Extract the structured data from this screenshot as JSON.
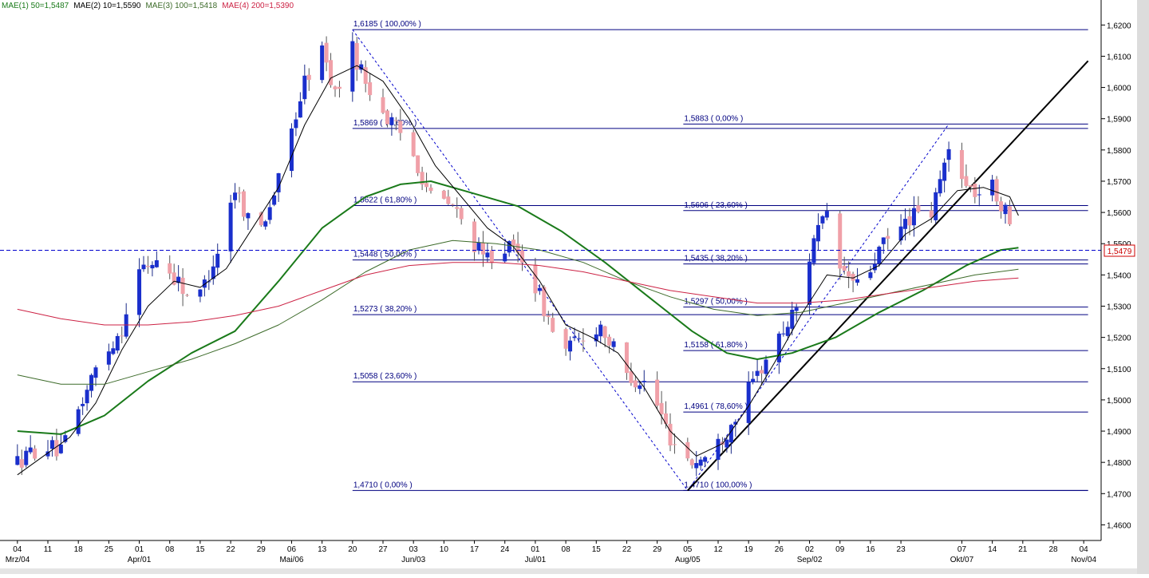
{
  "legend": [
    {
      "label": "MAE(1) 50=1,5487",
      "color": "#1a7a1a"
    },
    {
      "label": "MAE(2) 10=1,5590",
      "color": "#000000"
    },
    {
      "label": "MAE(3) 100=1,5418",
      "color": "#3d6b2a"
    },
    {
      "label": "MAE(4) 200=1,5390",
      "color": "#cc2244"
    }
  ],
  "current_price": "1,5479",
  "colors": {
    "bull": "#1a2fcc",
    "bear": "#f0a0a8",
    "fib": "#000080",
    "price_line": "#0000cc",
    "trend": "#000000"
  },
  "chart_data": {
    "type": "candlestick",
    "ylim": [
      1.455,
      1.628
    ],
    "yticks": [
      {
        "v": 1.46,
        "label": "1,4600"
      },
      {
        "v": 1.47,
        "label": "1,4700"
      },
      {
        "v": 1.48,
        "label": "1,4800"
      },
      {
        "v": 1.49,
        "label": "1,4900"
      },
      {
        "v": 1.5,
        "label": "1,5000"
      },
      {
        "v": 1.51,
        "label": "1,5100"
      },
      {
        "v": 1.52,
        "label": "1,5200"
      },
      {
        "v": 1.53,
        "label": "1,5300"
      },
      {
        "v": 1.54,
        "label": "1,5400"
      },
      {
        "v": 1.55,
        "label": "1,5500"
      },
      {
        "v": 1.56,
        "label": "1,5600"
      },
      {
        "v": 1.57,
        "label": "1,5700"
      },
      {
        "v": 1.58,
        "label": "1,5800"
      },
      {
        "v": 1.59,
        "label": "1,5900"
      },
      {
        "v": 1.6,
        "label": "1,6000"
      },
      {
        "v": 1.61,
        "label": "1,6100"
      },
      {
        "v": 1.62,
        "label": "1,6200"
      }
    ],
    "xticks": [
      {
        "d": 0,
        "label": "04"
      },
      {
        "d": 7,
        "label": "11"
      },
      {
        "d": 14,
        "label": "18"
      },
      {
        "d": 21,
        "label": "25"
      },
      {
        "d": 28,
        "label": "01"
      },
      {
        "d": 35,
        "label": "08"
      },
      {
        "d": 42,
        "label": "15"
      },
      {
        "d": 49,
        "label": "22"
      },
      {
        "d": 56,
        "label": "29"
      },
      {
        "d": 63,
        "label": "06"
      },
      {
        "d": 70,
        "label": "13"
      },
      {
        "d": 77,
        "label": "20"
      },
      {
        "d": 84,
        "label": "27"
      },
      {
        "d": 91,
        "label": "03"
      },
      {
        "d": 98,
        "label": "10"
      },
      {
        "d": 105,
        "label": "17"
      },
      {
        "d": 112,
        "label": "24"
      },
      {
        "d": 119,
        "label": "01"
      },
      {
        "d": 126,
        "label": "08"
      },
      {
        "d": 133,
        "label": "15"
      },
      {
        "d": 140,
        "label": "22"
      },
      {
        "d": 147,
        "label": "29"
      },
      {
        "d": 154,
        "label": "05"
      },
      {
        "d": 161,
        "label": "12"
      },
      {
        "d": 168,
        "label": "19"
      },
      {
        "d": 175,
        "label": "26"
      },
      {
        "d": 182,
        "label": "02"
      },
      {
        "d": 189,
        "label": "09"
      },
      {
        "d": 196,
        "label": "16"
      },
      {
        "d": 203,
        "label": "23"
      },
      {
        "d": 217,
        "label": "07"
      },
      {
        "d": 224,
        "label": "14"
      },
      {
        "d": 231,
        "label": "21"
      },
      {
        "d": 238,
        "label": "28"
      },
      {
        "d": 245,
        "label": "04"
      }
    ],
    "month_labels": [
      {
        "d": 0,
        "label": "Mrz/04"
      },
      {
        "d": 28,
        "label": "Apr/01"
      },
      {
        "d": 63,
        "label": "Mai/06"
      },
      {
        "d": 91,
        "label": "Jun/03"
      },
      {
        "d": 119,
        "label": "Jul/01"
      },
      {
        "d": 154,
        "label": "Aug/05"
      },
      {
        "d": 182,
        "label": "Sep/02"
      },
      {
        "d": 217,
        "label": "Okt/07"
      },
      {
        "d": 245,
        "label": "Nov/04"
      }
    ],
    "fib_sets": [
      {
        "d_start": 77,
        "d_end": 246,
        "levels": [
          {
            "v": 1.6185,
            "label": "1,6185 ( 100,00% )"
          },
          {
            "v": 1.5869,
            "label": "1,5869 ( 78,60% )"
          },
          {
            "v": 1.5622,
            "label": "1,5622 ( 61,80% )"
          },
          {
            "v": 1.5448,
            "label": "1,5448 ( 50,00% )"
          },
          {
            "v": 1.5273,
            "label": "1,5273 ( 38,20% )"
          },
          {
            "v": 1.5058,
            "label": "1,5058 ( 23,60% )"
          },
          {
            "v": 1.471,
            "label": "1,4710 ( 0,00% )"
          }
        ]
      },
      {
        "d_start": 153,
        "d_end": 246,
        "levels": [
          {
            "v": 1.5883,
            "label": "1,5883 ( 0,00% )"
          },
          {
            "v": 1.5606,
            "label": "1,5606 ( 23,60% )"
          },
          {
            "v": 1.5435,
            "label": "1,5435 ( 38,20% )"
          },
          {
            "v": 1.5297,
            "label": "1,5297 ( 50,00% )"
          },
          {
            "v": 1.5158,
            "label": "1,5158 ( 61,80% )"
          },
          {
            "v": 1.4961,
            "label": "1,4961 ( 78,60% )"
          },
          {
            "v": 1.471,
            "label": "1,4710 ( 100,00% )"
          }
        ]
      }
    ],
    "swing_lines": [
      {
        "d1": 77,
        "v1": 1.6185,
        "d2": 154,
        "v2": 1.471
      },
      {
        "d1": 154,
        "v1": 1.471,
        "d2": 214,
        "v2": 1.5883
      }
    ],
    "trend_line": {
      "d1": 154,
      "v1": 1.471,
      "d2": 246,
      "v2": 1.6085
    },
    "price_level": 1.5479,
    "pivots": [
      {
        "d": 0,
        "v": 1.48
      },
      {
        "d": 6,
        "v": 1.486
      },
      {
        "d": 10,
        "v": 1.483
      },
      {
        "d": 18,
        "v": 1.51
      },
      {
        "d": 24,
        "v": 1.523
      },
      {
        "d": 27,
        "v": 1.54
      },
      {
        "d": 32,
        "v": 1.545
      },
      {
        "d": 37,
        "v": 1.538
      },
      {
        "d": 41,
        "v": 1.53
      },
      {
        "d": 46,
        "v": 1.548
      },
      {
        "d": 50,
        "v": 1.568
      },
      {
        "d": 55,
        "v": 1.552
      },
      {
        "d": 60,
        "v": 1.57
      },
      {
        "d": 66,
        "v": 1.602
      },
      {
        "d": 70,
        "v": 1.612
      },
      {
        "d": 73,
        "v": 1.598
      },
      {
        "d": 77,
        "v": 1.612
      },
      {
        "d": 80,
        "v": 1.602
      },
      {
        "d": 85,
        "v": 1.59
      },
      {
        "d": 90,
        "v": 1.582
      },
      {
        "d": 95,
        "v": 1.565
      },
      {
        "d": 100,
        "v": 1.562
      },
      {
        "d": 103,
        "v": 1.555
      },
      {
        "d": 107,
        "v": 1.545
      },
      {
        "d": 112,
        "v": 1.549
      },
      {
        "d": 116,
        "v": 1.546
      },
      {
        "d": 120,
        "v": 1.533
      },
      {
        "d": 125,
        "v": 1.515
      },
      {
        "d": 130,
        "v": 1.52
      },
      {
        "d": 134,
        "v": 1.524
      },
      {
        "d": 140,
        "v": 1.508
      },
      {
        "d": 145,
        "v": 1.505
      },
      {
        "d": 150,
        "v": 1.488
      },
      {
        "d": 155,
        "v": 1.48
      },
      {
        "d": 159,
        "v": 1.482
      },
      {
        "d": 163,
        "v": 1.49
      },
      {
        "d": 168,
        "v": 1.503
      },
      {
        "d": 172,
        "v": 1.513
      },
      {
        "d": 176,
        "v": 1.522
      },
      {
        "d": 180,
        "v": 1.532
      },
      {
        "d": 183,
        "v": 1.553
      },
      {
        "d": 186,
        "v": 1.558
      },
      {
        "d": 189,
        "v": 1.542
      },
      {
        "d": 194,
        "v": 1.535
      },
      {
        "d": 198,
        "v": 1.548
      },
      {
        "d": 203,
        "v": 1.555
      },
      {
        "d": 206,
        "v": 1.56
      },
      {
        "d": 209,
        "v": 1.554
      },
      {
        "d": 212,
        "v": 1.57
      },
      {
        "d": 215,
        "v": 1.585
      },
      {
        "d": 218,
        "v": 1.568
      },
      {
        "d": 221,
        "v": 1.566
      },
      {
        "d": 224,
        "v": 1.568
      },
      {
        "d": 227,
        "v": 1.56
      },
      {
        "d": 230,
        "v": 1.547
      }
    ],
    "ma_lines": [
      {
        "name": "MAE(1) 50",
        "color": "#1a7a1a",
        "width": 2,
        "points": [
          {
            "d": 0,
            "v": 1.49
          },
          {
            "d": 10,
            "v": 1.489
          },
          {
            "d": 20,
            "v": 1.495
          },
          {
            "d": 30,
            "v": 1.506
          },
          {
            "d": 40,
            "v": 1.515
          },
          {
            "d": 50,
            "v": 1.522
          },
          {
            "d": 60,
            "v": 1.538
          },
          {
            "d": 70,
            "v": 1.555
          },
          {
            "d": 80,
            "v": 1.565
          },
          {
            "d": 88,
            "v": 1.569
          },
          {
            "d": 95,
            "v": 1.57
          },
          {
            "d": 105,
            "v": 1.566
          },
          {
            "d": 115,
            "v": 1.562
          },
          {
            "d": 125,
            "v": 1.554
          },
          {
            "d": 135,
            "v": 1.544
          },
          {
            "d": 145,
            "v": 1.533
          },
          {
            "d": 155,
            "v": 1.522
          },
          {
            "d": 163,
            "v": 1.515
          },
          {
            "d": 170,
            "v": 1.513
          },
          {
            "d": 178,
            "v": 1.515
          },
          {
            "d": 188,
            "v": 1.52
          },
          {
            "d": 198,
            "v": 1.528
          },
          {
            "d": 208,
            "v": 1.535
          },
          {
            "d": 218,
            "v": 1.543
          },
          {
            "d": 226,
            "v": 1.548
          },
          {
            "d": 230,
            "v": 1.5487
          }
        ]
      },
      {
        "name": "MAE(2) 10",
        "color": "#000000",
        "width": 1,
        "points": [
          {
            "d": 0,
            "v": 1.476
          },
          {
            "d": 6,
            "v": 1.482
          },
          {
            "d": 12,
            "v": 1.488
          },
          {
            "d": 18,
            "v": 1.499
          },
          {
            "d": 24,
            "v": 1.516
          },
          {
            "d": 30,
            "v": 1.53
          },
          {
            "d": 36,
            "v": 1.538
          },
          {
            "d": 42,
            "v": 1.536
          },
          {
            "d": 48,
            "v": 1.542
          },
          {
            "d": 54,
            "v": 1.555
          },
          {
            "d": 60,
            "v": 1.568
          },
          {
            "d": 66,
            "v": 1.588
          },
          {
            "d": 72,
            "v": 1.603
          },
          {
            "d": 78,
            "v": 1.607
          },
          {
            "d": 84,
            "v": 1.602
          },
          {
            "d": 90,
            "v": 1.59
          },
          {
            "d": 96,
            "v": 1.575
          },
          {
            "d": 102,
            "v": 1.565
          },
          {
            "d": 108,
            "v": 1.555
          },
          {
            "d": 114,
            "v": 1.549
          },
          {
            "d": 120,
            "v": 1.538
          },
          {
            "d": 126,
            "v": 1.524
          },
          {
            "d": 132,
            "v": 1.52
          },
          {
            "d": 138,
            "v": 1.515
          },
          {
            "d": 144,
            "v": 1.504
          },
          {
            "d": 150,
            "v": 1.49
          },
          {
            "d": 156,
            "v": 1.482
          },
          {
            "d": 162,
            "v": 1.486
          },
          {
            "d": 168,
            "v": 1.498
          },
          {
            "d": 174,
            "v": 1.512
          },
          {
            "d": 180,
            "v": 1.527
          },
          {
            "d": 186,
            "v": 1.54
          },
          {
            "d": 192,
            "v": 1.539
          },
          {
            "d": 198,
            "v": 1.543
          },
          {
            "d": 204,
            "v": 1.553
          },
          {
            "d": 210,
            "v": 1.558
          },
          {
            "d": 216,
            "v": 1.567
          },
          {
            "d": 222,
            "v": 1.568
          },
          {
            "d": 228,
            "v": 1.565
          },
          {
            "d": 230,
            "v": 1.559
          }
        ]
      },
      {
        "name": "MAE(3) 100",
        "color": "#3d6b2a",
        "width": 1,
        "points": [
          {
            "d": 0,
            "v": 1.508
          },
          {
            "d": 10,
            "v": 1.505
          },
          {
            "d": 20,
            "v": 1.505
          },
          {
            "d": 30,
            "v": 1.509
          },
          {
            "d": 40,
            "v": 1.513
          },
          {
            "d": 50,
            "v": 1.518
          },
          {
            "d": 60,
            "v": 1.524
          },
          {
            "d": 70,
            "v": 1.532
          },
          {
            "d": 80,
            "v": 1.541
          },
          {
            "d": 90,
            "v": 1.548
          },
          {
            "d": 100,
            "v": 1.551
          },
          {
            "d": 110,
            "v": 1.55
          },
          {
            "d": 120,
            "v": 1.548
          },
          {
            "d": 130,
            "v": 1.544
          },
          {
            "d": 140,
            "v": 1.538
          },
          {
            "d": 150,
            "v": 1.533
          },
          {
            "d": 160,
            "v": 1.529
          },
          {
            "d": 170,
            "v": 1.527
          },
          {
            "d": 180,
            "v": 1.528
          },
          {
            "d": 190,
            "v": 1.531
          },
          {
            "d": 200,
            "v": 1.534
          },
          {
            "d": 210,
            "v": 1.537
          },
          {
            "d": 220,
            "v": 1.54
          },
          {
            "d": 230,
            "v": 1.5418
          }
        ]
      },
      {
        "name": "MAE(4) 200",
        "color": "#cc2244",
        "width": 1,
        "points": [
          {
            "d": 0,
            "v": 1.529
          },
          {
            "d": 10,
            "v": 1.526
          },
          {
            "d": 20,
            "v": 1.524
          },
          {
            "d": 30,
            "v": 1.524
          },
          {
            "d": 40,
            "v": 1.525
          },
          {
            "d": 50,
            "v": 1.527
          },
          {
            "d": 60,
            "v": 1.53
          },
          {
            "d": 70,
            "v": 1.535
          },
          {
            "d": 80,
            "v": 1.54
          },
          {
            "d": 90,
            "v": 1.543
          },
          {
            "d": 100,
            "v": 1.544
          },
          {
            "d": 110,
            "v": 1.544
          },
          {
            "d": 120,
            "v": 1.543
          },
          {
            "d": 130,
            "v": 1.541
          },
          {
            "d": 140,
            "v": 1.538
          },
          {
            "d": 150,
            "v": 1.535
          },
          {
            "d": 160,
            "v": 1.533
          },
          {
            "d": 170,
            "v": 1.531
          },
          {
            "d": 180,
            "v": 1.531
          },
          {
            "d": 190,
            "v": 1.532
          },
          {
            "d": 200,
            "v": 1.534
          },
          {
            "d": 210,
            "v": 1.536
          },
          {
            "d": 220,
            "v": 1.538
          },
          {
            "d": 230,
            "v": 1.539
          }
        ]
      }
    ]
  }
}
